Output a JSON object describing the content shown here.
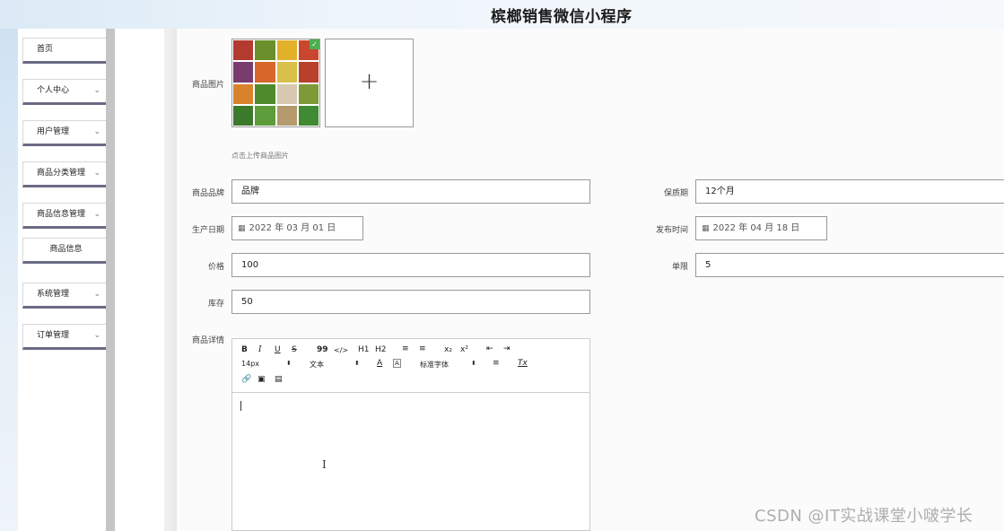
{
  "header": {
    "title": "槟榔销售微信小程序"
  },
  "sidebar": {
    "items": [
      {
        "label": "首页",
        "has_chevron": false
      },
      {
        "label": "个人中心",
        "has_chevron": true
      },
      {
        "label": "用户管理",
        "has_chevron": true
      },
      {
        "label": "商品分类管理",
        "has_chevron": true
      },
      {
        "label": "商品信息管理",
        "has_chevron": true
      },
      {
        "label": "商品信息",
        "is_sub": true
      },
      {
        "label": "系统管理",
        "has_chevron": true
      },
      {
        "label": "订单管理",
        "has_chevron": true
      }
    ],
    "chevron_icon": "chevron-down-icon"
  },
  "form": {
    "image": {
      "label": "商品图片",
      "hint": "点击上传商品图片",
      "upload_icon": "+",
      "uploaded_check": "✓"
    },
    "brand": {
      "label": "商品品牌",
      "value": "品牌"
    },
    "shelf_life": {
      "label": "保质期",
      "value": "12个月"
    },
    "production_date": {
      "label": "生产日期",
      "value": "2022 年 03 月 01 日"
    },
    "release_time": {
      "label": "发布时间",
      "value": "2022 年 04 月 18 日"
    },
    "price": {
      "label": "价格",
      "value": "100"
    },
    "limit": {
      "label": "单限",
      "value": "5"
    },
    "stock": {
      "label": "库存",
      "value": "50"
    },
    "detail": {
      "label": "商品详情"
    }
  },
  "editor": {
    "row1": [
      "B",
      "I",
      "U",
      "S",
      "99",
      "</>",
      "H1",
      "H2",
      "≡",
      "≡",
      "x₂",
      "x²",
      "⇤",
      "⇥"
    ],
    "font_size": "14px",
    "block_type": "文本",
    "font_color": "A",
    "bg_color": "A",
    "font_family": "标准字体",
    "align": "≡",
    "clear": "Tx"
  },
  "watermark": "CSDN @IT实战课堂小啵学长",
  "colors": {
    "menu_shadow": "#6a6a86",
    "check": "#4caf50"
  }
}
